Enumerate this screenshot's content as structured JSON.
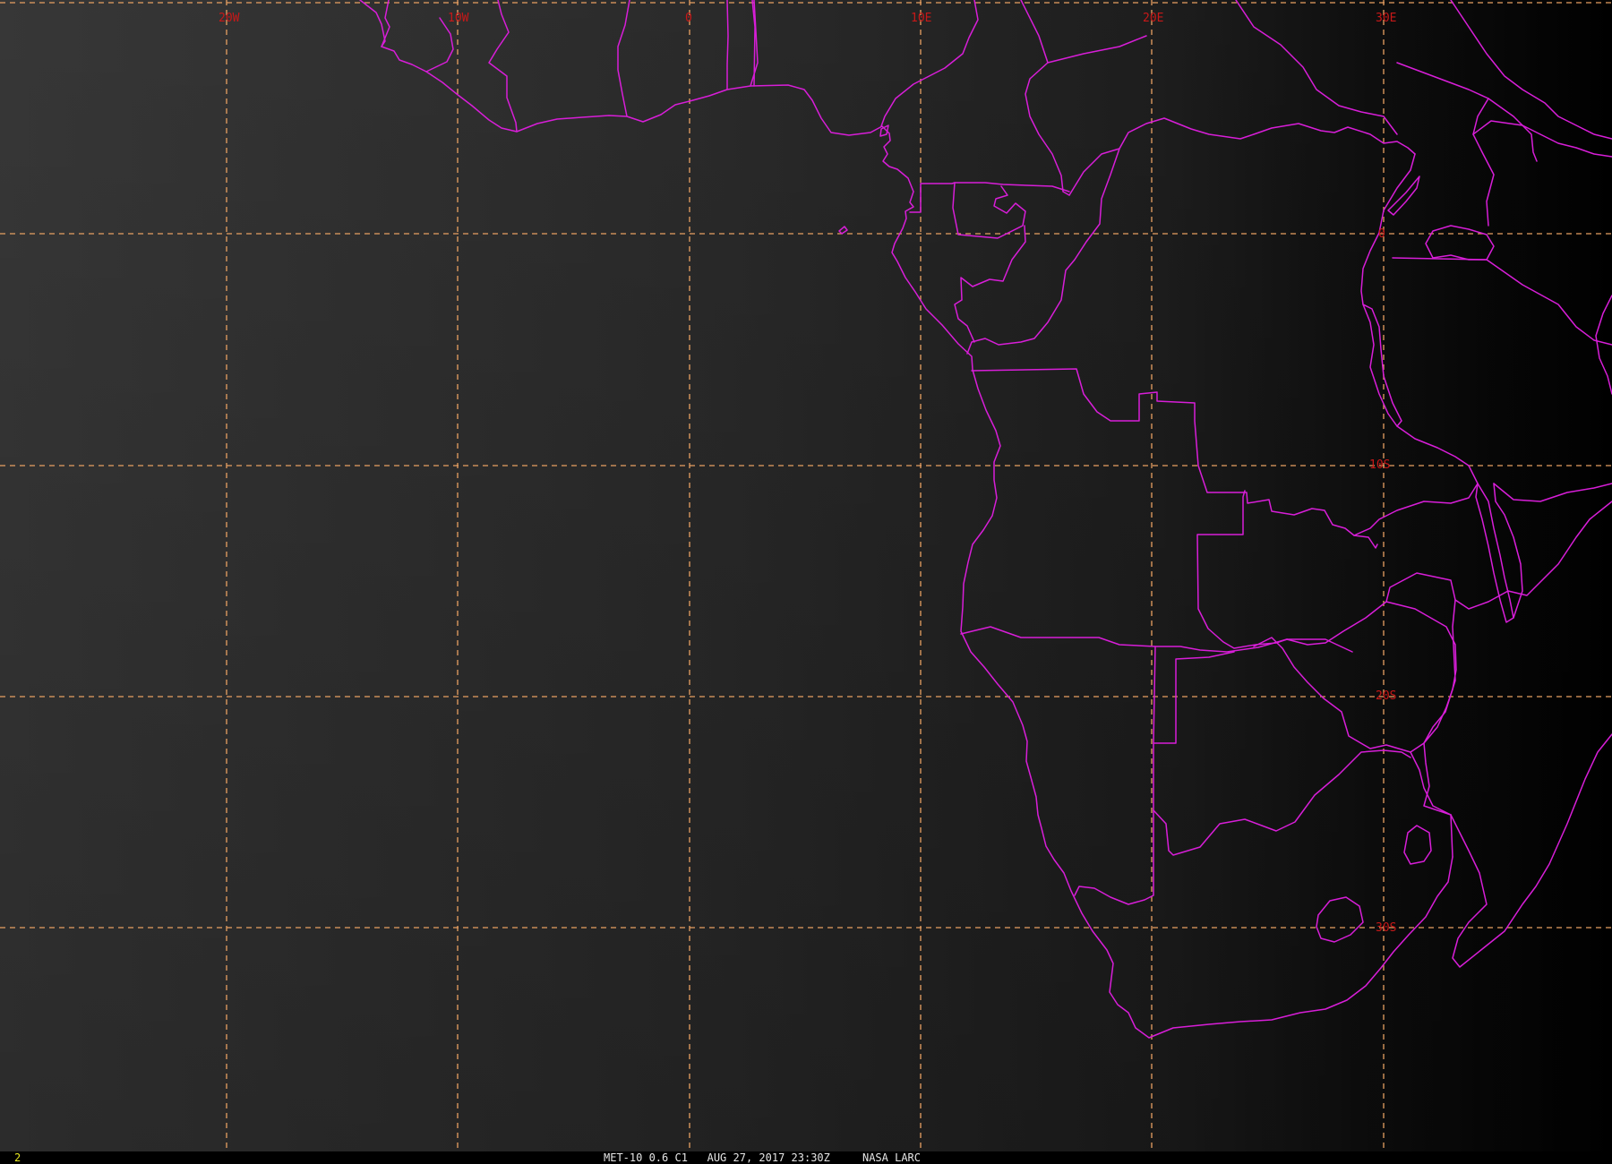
{
  "image": {
    "satellite_caption": "MET-10 0.6 C1   AUG 27, 2017 23:30Z     NASA LARC",
    "frame_number": "2"
  },
  "grid": {
    "longitude_labels": [
      "20W",
      "10W",
      "0",
      "10E",
      "20E",
      "30E"
    ],
    "latitude_labels": [
      "0",
      "10S",
      "20S",
      "30S"
    ]
  },
  "style": {
    "background": "#000000",
    "grid_line_color": "#e8a062",
    "grid_label_color": "#c81818",
    "border_color": "#d81ed8",
    "caption_color": "#e6e6e6",
    "frame_number_color": "#e8e820"
  }
}
